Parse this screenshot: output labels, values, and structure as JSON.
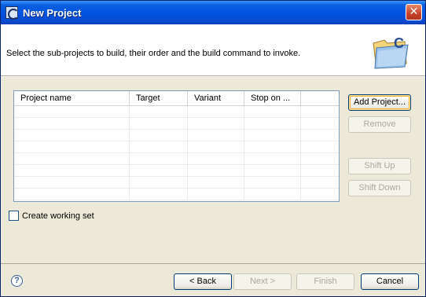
{
  "window": {
    "title": "New Project"
  },
  "header": {
    "message": "Select the sub-projects to build, their order and the build command to invoke."
  },
  "table": {
    "columns": [
      "Project name",
      "Target",
      "Variant",
      "Stop on ..."
    ]
  },
  "buttons": {
    "add_project": "Add Project...",
    "remove": "Remove",
    "shift_up": "Shift Up",
    "shift_down": "Shift Down",
    "back": "< Back",
    "next": "Next >",
    "finish": "Finish",
    "cancel": "Cancel"
  },
  "options": {
    "create_working_set": "Create working set"
  },
  "icons": {
    "close": "close-icon",
    "app": "app-icon",
    "banner": "new-c-project-folder-icon",
    "help": "help-icon"
  },
  "colors": {
    "titlebar": "#0053e1",
    "accent_focus": "#f8b33a"
  }
}
